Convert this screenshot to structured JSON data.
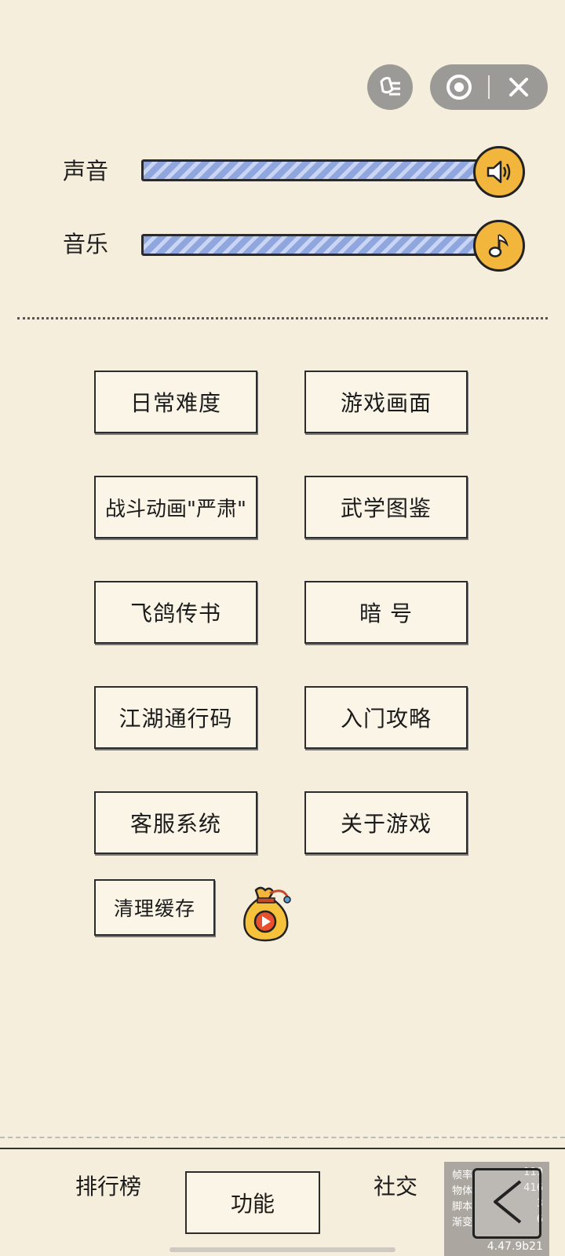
{
  "settings": {
    "sound": {
      "label": "声音",
      "level": 1.0
    },
    "music": {
      "label": "音乐",
      "level": 1.0
    }
  },
  "buttons": [
    {
      "id": "daily-difficulty",
      "label": "日常难度"
    },
    {
      "id": "game-graphics",
      "label": "游戏画面"
    },
    {
      "id": "battle-animation",
      "label": "战斗动画\"严肃\""
    },
    {
      "id": "martial-arts-guide",
      "label": "武学图鉴"
    },
    {
      "id": "pigeon-mail",
      "label": "飞鸽传书"
    },
    {
      "id": "secret-code",
      "label": "暗 号"
    },
    {
      "id": "jianghu-pass",
      "label": "江湖通行码"
    },
    {
      "id": "beginner-guide",
      "label": "入门攻略"
    },
    {
      "id": "customer-service",
      "label": "客服系统"
    },
    {
      "id": "about-game",
      "label": "关于游戏"
    }
  ],
  "clear_cache": {
    "label": "清理缓存"
  },
  "tabs": {
    "rankings": "排行榜",
    "functions": "功能",
    "social": "社交"
  },
  "debug": {
    "rows": [
      {
        "k": "帧率",
        "v": "119"
      },
      {
        "k": "物体",
        "v": "416"
      },
      {
        "k": "脚本",
        "v": "3"
      },
      {
        "k": "渐变",
        "v": "6"
      }
    ],
    "version": "4.47.9b21"
  },
  "colors": {
    "background": "#f6eedd",
    "knob": "#f3b63d",
    "track": "#8fa6df"
  },
  "icons": {
    "sound_knob": "speaker-icon",
    "music_knob": "music-note-icon"
  }
}
